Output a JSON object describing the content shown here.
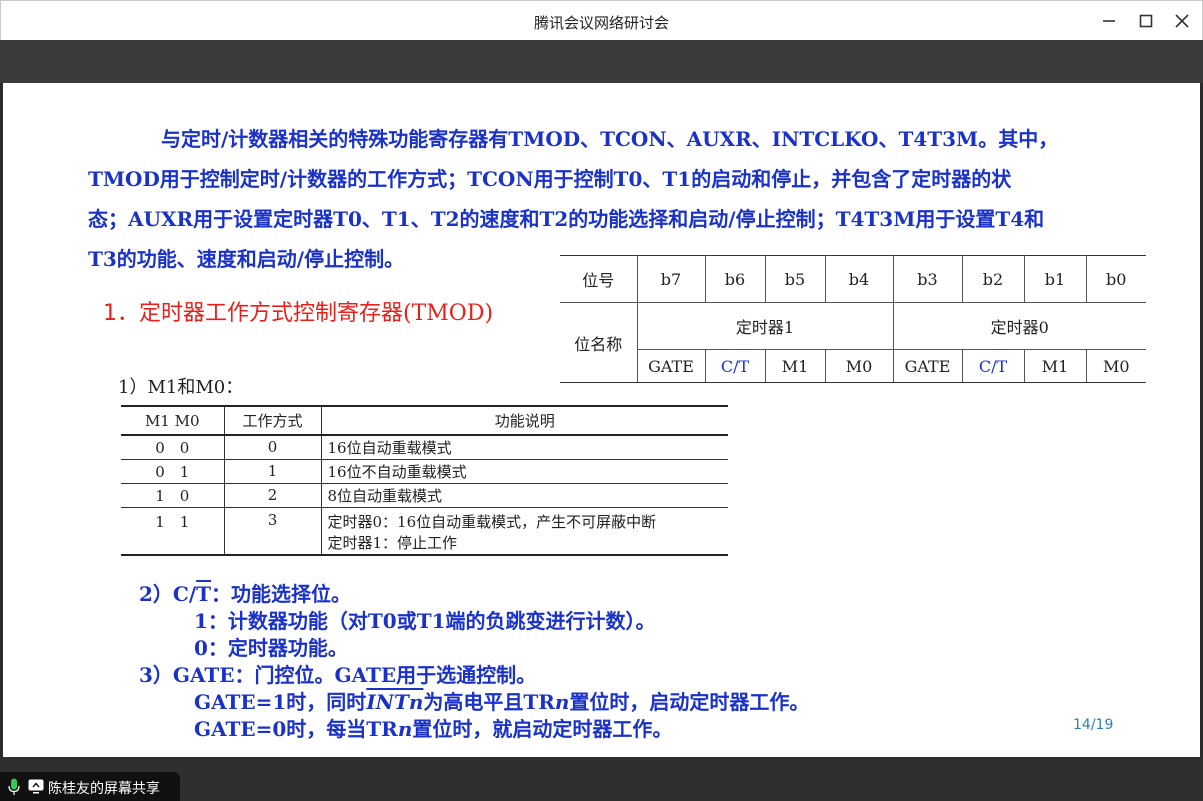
{
  "window": {
    "title": "腾讯会议网络研讨会",
    "controls": {
      "minimize": "minimize-icon",
      "maximize": "maximize-icon",
      "close": "close-icon"
    }
  },
  "slide": {
    "intro_lines": [
      "与定时/计数器相关的特殊功能寄存器有TMOD、TCON、AUXR、INTCLKO、T4T3M。其中，",
      "TMOD用于控制定时/计数器的工作方式；TCON用于控制T0、T1的启动和停止，并包含了定时器的状",
      "态；AUXR用于设置定时器T0、T1、T2的速度和T2的功能选择和启动/停止控制；T4T3M用于设置T4和",
      "T3的功能、速度和启动/停止控制。"
    ],
    "heading": "1．定时器工作方式控制寄存器",
    "heading_paren": "(TMOD)",
    "bit_table": {
      "row_label_bits": "位号",
      "bits": [
        "b7",
        "b6",
        "b5",
        "b4",
        "b3",
        "b2",
        "b1",
        "b0"
      ],
      "row_label_names": "位名称",
      "group1": "定时器1",
      "group0": "定时器0",
      "names": [
        "GATE",
        "C/T",
        "M1",
        "M0",
        "GATE",
        "C/T",
        "M1",
        "M0"
      ]
    },
    "sub_heading": "1）M1和M0：",
    "mode_table": {
      "headers": [
        "M1 M0",
        "工作方式",
        "功能说明"
      ],
      "rows": [
        {
          "bits": "0　0",
          "mode": "0",
          "desc": "16位自动重载模式"
        },
        {
          "bits": "0　1",
          "mode": "1",
          "desc": "16位不自动重载模式"
        },
        {
          "bits": "1　0",
          "mode": "2",
          "desc": "8位自动重载模式"
        },
        {
          "bits": "1　1",
          "mode": "3",
          "desc": "定时器0：16位自动重载模式，产生不可屏蔽中断",
          "desc2": "定时器1：停止工作"
        }
      ]
    },
    "notes": {
      "ct_prefix": "2）C/",
      "ct_bar": "T",
      "ct_suffix": "：功能选择位。",
      "ct_1": "1：计数器功能（对T0或T1端的负跳变进行计数）。",
      "ct_0": "0：定时器功能。",
      "gate_title": "3）GATE：门控位。GATE用于选通控制。",
      "gate1_a": "GATE=1时，同时",
      "gate1_int": "INTn",
      "gate1_b": "为高电平且TR",
      "gate1_n": "n",
      "gate1_c": "置位时，启动定时器工作。",
      "gate0_a": "GATE=0时，每当TR",
      "gate0_n": "n",
      "gate0_b": "置位时，就启动定时器工作。"
    },
    "page_number": "14/19"
  },
  "share_badge": {
    "label": "陈桂友的屏幕共享",
    "icons": [
      "microphone-icon",
      "screen-share-icon"
    ],
    "mic_color": "#35c759"
  }
}
